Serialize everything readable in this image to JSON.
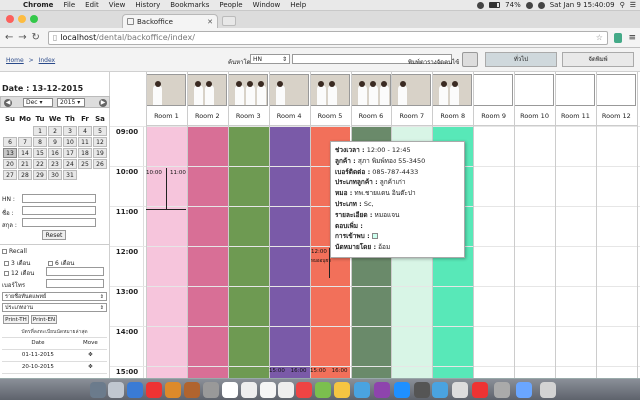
{
  "os_menubar": {
    "app_name": "Chrome",
    "menus": [
      "File",
      "Edit",
      "View",
      "History",
      "Bookmarks",
      "People",
      "Window",
      "Help"
    ],
    "battery": "74%",
    "datetime": "Sat Jan 9  15:40:09"
  },
  "browser": {
    "tab_title": "Backoffice",
    "url_host": "localhost",
    "url_path": "/dental/backoffice/index/"
  },
  "header": {
    "breadcrumb_home": "Home",
    "breadcrumb_sep": ">",
    "breadcrumb_current": "Index",
    "search_label": "ค้นหาโดย:",
    "search_field_value": "HN",
    "print_label": "พิมพ์ตารางจัดคนไข้",
    "view_general": "ทั่วไป",
    "view_arrange": "จัดพิมพ์"
  },
  "sidebar": {
    "date_label": "Date : 13-12-2015",
    "month": "Dec",
    "year": "2015",
    "weekdays": [
      "Su",
      "Mo",
      "Tu",
      "We",
      "Th",
      "Fr",
      "Sa"
    ],
    "weeks": [
      [
        "",
        "",
        "1",
        "2",
        "3",
        "4",
        "5"
      ],
      [
        "6",
        "7",
        "8",
        "9",
        "10",
        "11",
        "12"
      ],
      [
        "13",
        "14",
        "15",
        "16",
        "17",
        "18",
        "19"
      ],
      [
        "20",
        "21",
        "22",
        "23",
        "24",
        "25",
        "26"
      ],
      [
        "27",
        "28",
        "29",
        "30",
        "31",
        "",
        ""
      ]
    ],
    "today": "13",
    "hn_label": "HN :",
    "name_label": "ชื่อ :",
    "surname_label": "สกุล :",
    "reset_label": "Reset",
    "recall_label": "Recall",
    "recall_3m": "3 เดือน",
    "recall_6m": "6 เดือน",
    "recall_12m": "12 เดือน",
    "phone_label": "เบอร์โทร",
    "doctor_select": "รายชื่อทันตแพทย์",
    "type_select": "ประเภทงาน",
    "print_th": "Print-TH",
    "print_en": "Print-EN",
    "history_caption": "บัตรที่ลงทะเบียนนัดหมายล่าสุด",
    "history_headers": [
      "Date",
      "Move"
    ],
    "history_rows": [
      {
        "date": "01-11-2015",
        "move": "✥"
      },
      {
        "date": "20-10-2015",
        "move": "✥"
      }
    ]
  },
  "schedule": {
    "rooms": [
      "Room 1",
      "Room 2",
      "Room 3",
      "Room 4",
      "Room 5",
      "Room 6",
      "Room 7",
      "Room 8",
      "Room 9",
      "Room 10",
      "Room 11",
      "Room 12"
    ],
    "times": [
      "09:00",
      "10:00",
      "11:00",
      "12:00",
      "13:00",
      "14:00",
      "15:00"
    ],
    "room_colors": [
      "#f6c5dc",
      "#d86f96",
      "#6e9a52",
      "#7a5aa8",
      "#f2705a",
      "#6a8a6a",
      "#d8f5e6",
      "#58e8b8",
      "#ffffff",
      "#ffffff",
      "#ffffff",
      "#ffffff"
    ],
    "appt_room1_start": "10:00",
    "appt_room1_end": "11:00",
    "appt_room5_start": "12:00",
    "appt_room5_note": "หมออนุชา",
    "bottom_room4_a": "15:00",
    "bottom_room4_b": "16:00",
    "bottom_room5_a": "15:00",
    "bottom_room5_b": "16:00"
  },
  "tooltip": {
    "time_k": "ช่วงเวลา :",
    "time_v": "12:00 - 12:45",
    "customer_k": "ลูกค้า :",
    "customer_v": "สุภา พิมพ์ทอง 55-3450",
    "phone_k": "เบอร์ติดต่อ :",
    "phone_v": "085-787-4433",
    "ctype_k": "ประเภทลูกค้า :",
    "ctype_v": "ลูกค้าเก่า",
    "doctor_k": "หมอ :",
    "doctor_v": "ทพ.ชายแดน อินต๊ะปา",
    "type_k": "ประเภท :",
    "type_v": "Sc,",
    "detail_k": "รายละเอียด :",
    "detail_v": "หมอแจน",
    "extra_k": "ตอบเพิ่ม :",
    "action_k": "การเข้าพบ :",
    "appointer_k": "นัดหมายโดย :",
    "appointer_v": "อ้อม"
  }
}
